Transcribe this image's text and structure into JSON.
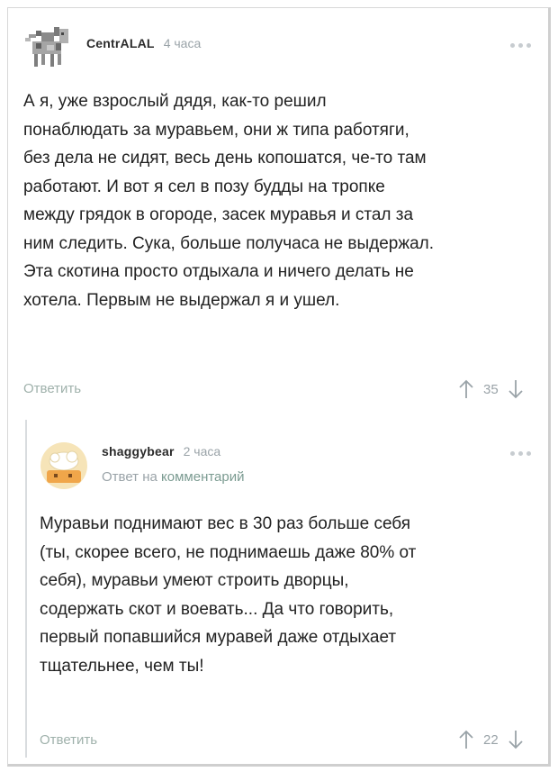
{
  "comment": {
    "author": "CentrALAL",
    "time": "4 часа",
    "lines": [
      "А я, уже взрослый дядя, как-то решил",
      "понаблюдать за муравьем, они ж типа работяги,",
      "без дела не сидят, весь день копошатся, че-то там",
      "работают. И вот я сел в позу будды на тропке",
      "между грядок в огороде, засек муравья и стал за",
      "ним следить. Сука, больше получаса не выдержал.",
      "Эта скотина просто отдыхала и ничего делать не",
      "хотела. Первым не выдержал я и ушел."
    ],
    "reply_label": "Ответить",
    "rating": "35"
  },
  "reply_comment": {
    "author": "shaggybear",
    "time": "2 часа",
    "reply_to_prefix": "Ответ на",
    "reply_to_link": "комментарий",
    "lines": [
      "Муравьи поднимают вес в 30 раз больше себя",
      "(ты, скорее всего, не поднимаешь даже 80% от",
      "себя), муравьи умеют строить дворцы,",
      "содержать скот и воевать... Да что говорить,",
      "первый попавшийся муравей даже отдыхает",
      "тщательнее, чем ты!"
    ],
    "reply_label": "Ответить",
    "rating": "22"
  }
}
